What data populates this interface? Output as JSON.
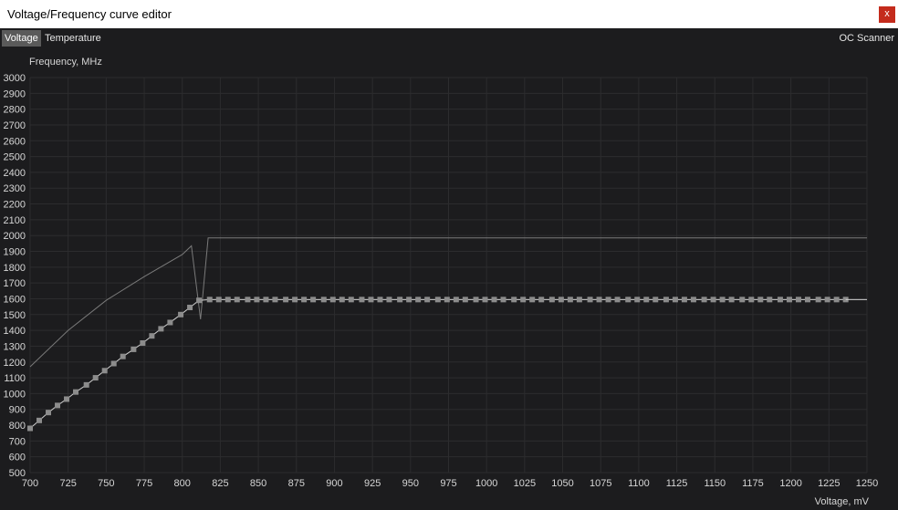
{
  "window": {
    "title": "Voltage/Frequency curve editor",
    "close_label": "x"
  },
  "tabs": [
    {
      "label": "Voltage",
      "active": true
    },
    {
      "label": "Temperature",
      "active": false
    }
  ],
  "oc_scanner_label": "OC Scanner",
  "colors": {
    "background": "#1c1c1e",
    "grid": "#2c2c2e",
    "curve": "#7a7a7a",
    "points": "#8c8c8c",
    "flat_line": "#cfcfcf",
    "close_button": "#c42b1c"
  },
  "chart_data": {
    "type": "line",
    "xlabel": "Voltage, mV",
    "ylabel": "Frequency, MHz",
    "xlim": [
      700,
      1250
    ],
    "ylim": [
      500,
      3000
    ],
    "x_ticks": [
      700,
      725,
      750,
      775,
      800,
      825,
      850,
      875,
      900,
      925,
      950,
      975,
      1000,
      1025,
      1050,
      1075,
      1100,
      1125,
      1150,
      1175,
      1200,
      1225,
      1250
    ],
    "y_ticks": [
      3000,
      2900,
      2800,
      2700,
      2600,
      2500,
      2400,
      2300,
      2200,
      2100,
      2000,
      1900,
      1800,
      1700,
      1600,
      1500,
      1400,
      1300,
      1200,
      1100,
      1000,
      900,
      800,
      700,
      600,
      500
    ],
    "grid": true,
    "series": [
      {
        "style": "thin-line",
        "x": [
          700,
          725,
          750,
          775,
          800,
          806,
          812,
          817,
          1250
        ],
        "y": [
          1170,
          1400,
          1590,
          1740,
          1880,
          1935,
          1470,
          1985,
          1985
        ]
      },
      {
        "style": "markers",
        "x": [
          700,
          706,
          712,
          718,
          724,
          730,
          737,
          743,
          749,
          755,
          761,
          768,
          774,
          780,
          786,
          792,
          799,
          805,
          811,
          818,
          824,
          830,
          836,
          843,
          849,
          855,
          861,
          868,
          874,
          880,
          886,
          893,
          899,
          905,
          911,
          918,
          924,
          930,
          936,
          943,
          949,
          955,
          961,
          968,
          974,
          980,
          986,
          993,
          999,
          1005,
          1011,
          1018,
          1024,
          1030,
          1036,
          1043,
          1049,
          1055,
          1061,
          1068,
          1074,
          1080,
          1086,
          1093,
          1099,
          1105,
          1111,
          1118,
          1124,
          1130,
          1136,
          1143,
          1149,
          1155,
          1161,
          1168,
          1174,
          1180,
          1186,
          1193,
          1199,
          1205,
          1211,
          1218,
          1224,
          1230,
          1236
        ],
        "y": [
          780,
          830,
          880,
          925,
          965,
          1010,
          1055,
          1100,
          1145,
          1190,
          1235,
          1280,
          1320,
          1365,
          1410,
          1450,
          1500,
          1545,
          1590,
          1595,
          1595,
          1595,
          1595,
          1595,
          1595,
          1595,
          1595,
          1595,
          1595,
          1595,
          1595,
          1595,
          1595,
          1595,
          1595,
          1595,
          1595,
          1595,
          1595,
          1595,
          1595,
          1595,
          1595,
          1595,
          1595,
          1595,
          1595,
          1595,
          1595,
          1595,
          1595,
          1595,
          1595,
          1595,
          1595,
          1595,
          1595,
          1595,
          1595,
          1595,
          1595,
          1595,
          1595,
          1595,
          1595,
          1595,
          1595,
          1595,
          1595,
          1595,
          1595,
          1595,
          1595,
          1595,
          1595,
          1595,
          1595,
          1595,
          1595,
          1595,
          1595,
          1595,
          1595,
          1595,
          1595,
          1595,
          1595
        ]
      },
      {
        "style": "flat-line",
        "x": [
          1236,
          1250
        ],
        "y": [
          1595,
          1595
        ]
      }
    ]
  }
}
